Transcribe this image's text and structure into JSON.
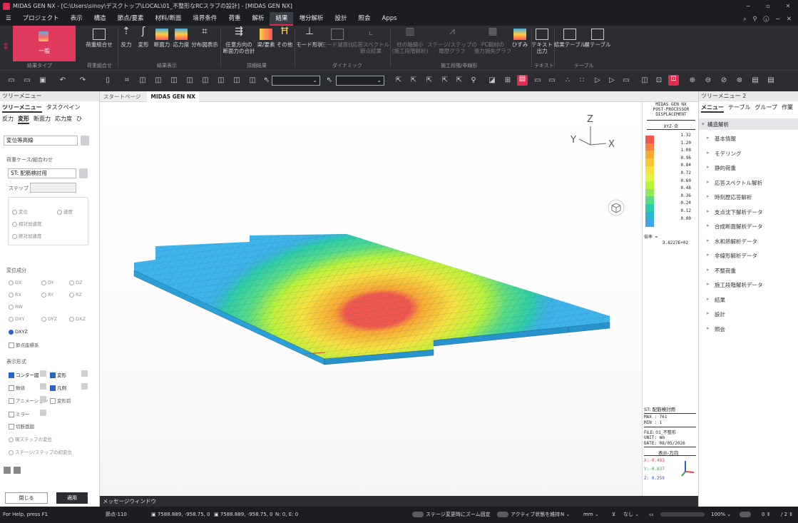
{
  "window": {
    "title": "MIDAS GEN NX - [C:\\Users\\sinoy\\デスクトップ\\LOCAL\\01_不整形なRCスラブの設計] - [MIDAS GEN NX]"
  },
  "menu": [
    "プロジェクト",
    "表示",
    "構造",
    "節点/要素",
    "材料/断面",
    "境界条件",
    "荷重",
    "解析",
    "結果",
    "増分解析",
    "設計",
    "照会",
    "Apps"
  ],
  "ribbon": {
    "general": "一般",
    "buttons": [
      "荷重組合せ",
      "反力",
      "変形",
      "断面力",
      "応力度",
      "分布図表示",
      "任意方向の\n断面力の合計",
      "梁/要素",
      "その他",
      "モード形状",
      "モード減衰比",
      "応答スペクトル\n節点結果",
      "柱の軸縮小\n(施工段階解析)",
      "ステージ/ステップの\n履歴グラフ",
      "PC鋼材の\n張力損失グラフ",
      "ひずみ",
      "テキスト\n出力",
      "結果テーブル",
      "層テーブル"
    ],
    "groups": [
      "結果タイプ",
      "荷重組合せ",
      "結果表示",
      "詳細結果",
      "ダイナミック",
      "施工段階/非線形",
      "テキスト",
      "テーブル"
    ]
  },
  "left_panel": {
    "header": "ツリーメニュー",
    "tabs": [
      "ツリーメニュー",
      "タスクペイン"
    ],
    "result_tabs": [
      "反力",
      "変形",
      "断面力",
      "応力度",
      "ひ"
    ],
    "mode": "変位等高線",
    "loadcase_label": "荷重ケース/組合わせ",
    "loadcase": "ST: 配筋検討用",
    "step_label": "ステップ",
    "motion": [
      "変位",
      "速度",
      "相対加速度",
      "絶対加速度"
    ],
    "component_label": "変位成分",
    "components": [
      "DX",
      "DY",
      "DZ",
      "RX",
      "RY",
      "RZ",
      "RW",
      "DXY",
      "DYZ",
      "DXZ",
      "DXYZ"
    ],
    "selected_component": "DXYZ",
    "local_axis": "節点座標系",
    "display_label": "表示形式",
    "display_opts": [
      "コンター図",
      "変形",
      "数値",
      "凡例",
      "アニメーション",
      "変形前",
      "ミラー",
      "切断面図",
      "現ステップの変位",
      "ステージ/ステップの初変位"
    ],
    "close": "閉じる",
    "apply": "適用"
  },
  "doc_tabs": [
    "スタートページ",
    "MIDAS GEN NX"
  ],
  "legend": {
    "title": [
      "MIDAS GEN NX",
      "POST-PROCESSOR",
      "DISPLACEMENT"
    ],
    "component": "XYZ-合",
    "values": [
      "1.32",
      "1.20",
      "1.08",
      "0.96",
      "0.84",
      "0.72",
      "0.60",
      "0.48",
      "0.36",
      "0.24",
      "0.12",
      "0.00"
    ],
    "colors": [
      "#f0584e",
      "#f5843d",
      "#f8a835",
      "#f8c535",
      "#f5e140",
      "#e4f33e",
      "#bdf23a",
      "#8ee85a",
      "#57db86",
      "#2fcbab",
      "#2db6d4",
      "#3fa6ea"
    ],
    "scale_label": "倍率 =",
    "scale_value": "3.8227E+02",
    "loadcase": "ST: 配筋検討用",
    "max": "MAX : 761",
    "min": "MIN : 1",
    "file": "FILE: 01_不整形",
    "unit": "UNIT: mm",
    "date": "DATE: 08/05/2026",
    "view_dir": "表示-方向",
    "vx": "X:-0.483",
    "vy": "Y:-0.837",
    "vz": "Z: 0.259"
  },
  "axes": {
    "z": "Z",
    "y": "Y",
    "x": "X"
  },
  "right_panel": {
    "header": "ツリーメニュー 2",
    "tabs": [
      "メニュー",
      "テーブル",
      "グループ",
      "作業"
    ],
    "root": "構造解析",
    "items": [
      "基本情報",
      "モデリング",
      "静的荷重",
      "応答スペクトル解析",
      "時刻歴応答解析",
      "支点沈下解析データ",
      "合成断面解析データ",
      "水和熱解析データ",
      "非線形解析データ",
      "不整荷重",
      "施工段階解析データ",
      "結果",
      "設計",
      "照会"
    ]
  },
  "message": "メッセージウィンドウ",
  "status": {
    "help": "For Help, press F1",
    "node": "節点-110",
    "coord1": "7588.889, -958.75, 0",
    "coord2": "7588.889, -958.75, 0",
    "ne": "N: 0, E: 0",
    "zoom_fix": "ステージ変更時にズーム固定",
    "keep_active": "アクティブ状態を維持",
    "force_unit": "N",
    "len_unit": "mm",
    "none": "なし",
    "zoom": "100%",
    "page": "0",
    "page2": "2"
  }
}
